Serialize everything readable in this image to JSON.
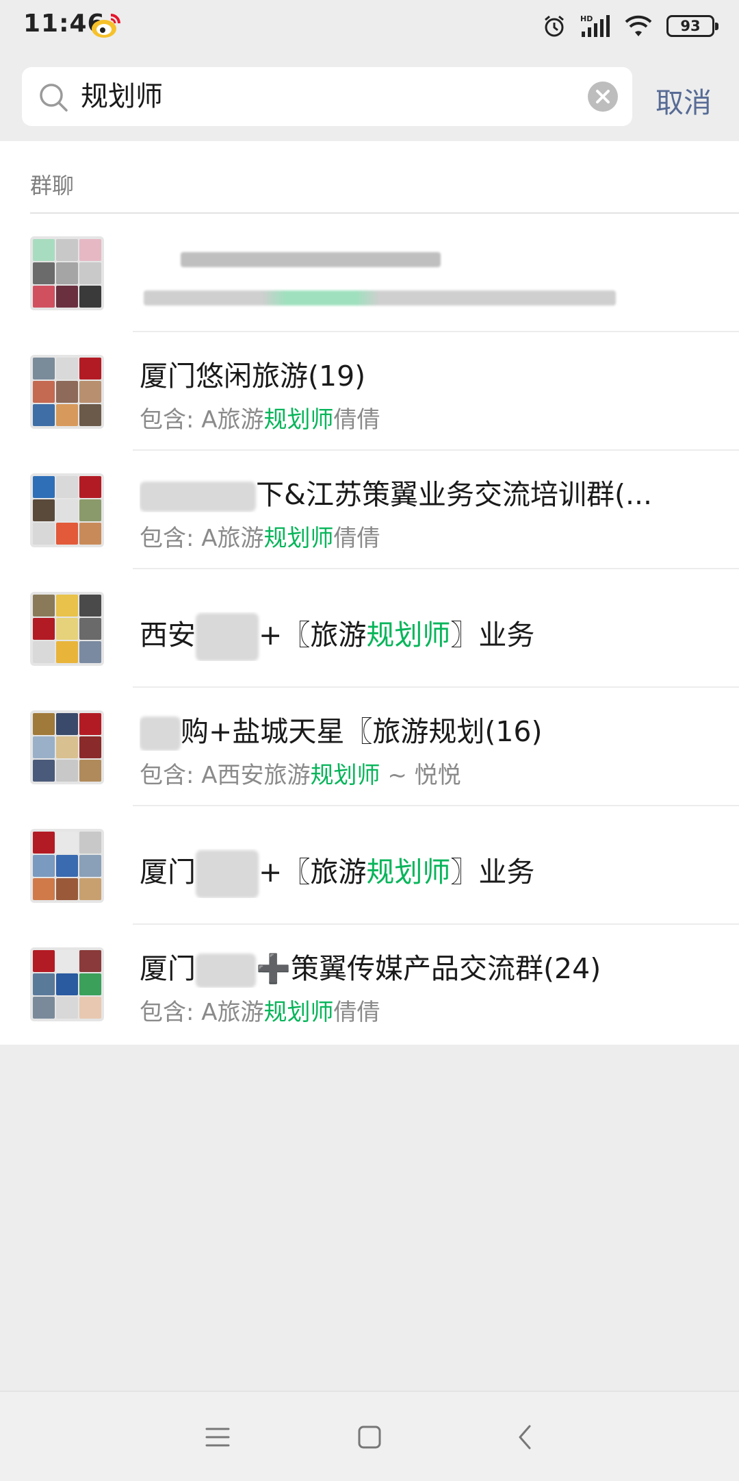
{
  "status_bar": {
    "time": "11:46",
    "battery": "93",
    "icons": [
      "weibo-icon",
      "alarm-icon",
      "hd-signal-icon",
      "wifi-icon",
      "battery-icon"
    ]
  },
  "search": {
    "query": "规划师",
    "cancel_label": "取消"
  },
  "section": {
    "title": "群聊"
  },
  "results": [
    {
      "title_a": "",
      "title_b": "",
      "highlight": "",
      "title_c": "",
      "sub_prefix": "",
      "sub_highlight": "",
      "sub_suffix": ""
    },
    {
      "title_a": "厦门悠闲旅游(19)",
      "sub_prefix": "包含: A旅游",
      "sub_highlight": "规划师",
      "sub_suffix": "倩倩"
    },
    {
      "title_a": "",
      "title_b": "下&江苏策翼业务交流培训群(...",
      "sub_prefix": "包含: A旅游",
      "sub_highlight": "规划师",
      "sub_suffix": "倩倩"
    },
    {
      "title_a": "西安",
      "title_b": "+〖旅游",
      "highlight": "规划师",
      "title_c": "〗业务"
    },
    {
      "title_a": "",
      "title_b": "购+盐城天星〖旅游规划(16)",
      "sub_prefix": "包含: A西安旅游",
      "sub_highlight": "规划师",
      "sub_suffix": " ~ 悦悦"
    },
    {
      "title_a": "厦门",
      "title_b": "+〖旅游",
      "highlight": "规划师",
      "title_c": "〗业务"
    },
    {
      "title_a": "厦门",
      "title_b": "➕策翼传媒产品交流群(24)",
      "sub_prefix": "包含: A旅游",
      "sub_highlight": "规划师",
      "sub_suffix": "倩倩"
    }
  ],
  "nav": [
    "menu-icon",
    "home-icon",
    "back-icon"
  ]
}
